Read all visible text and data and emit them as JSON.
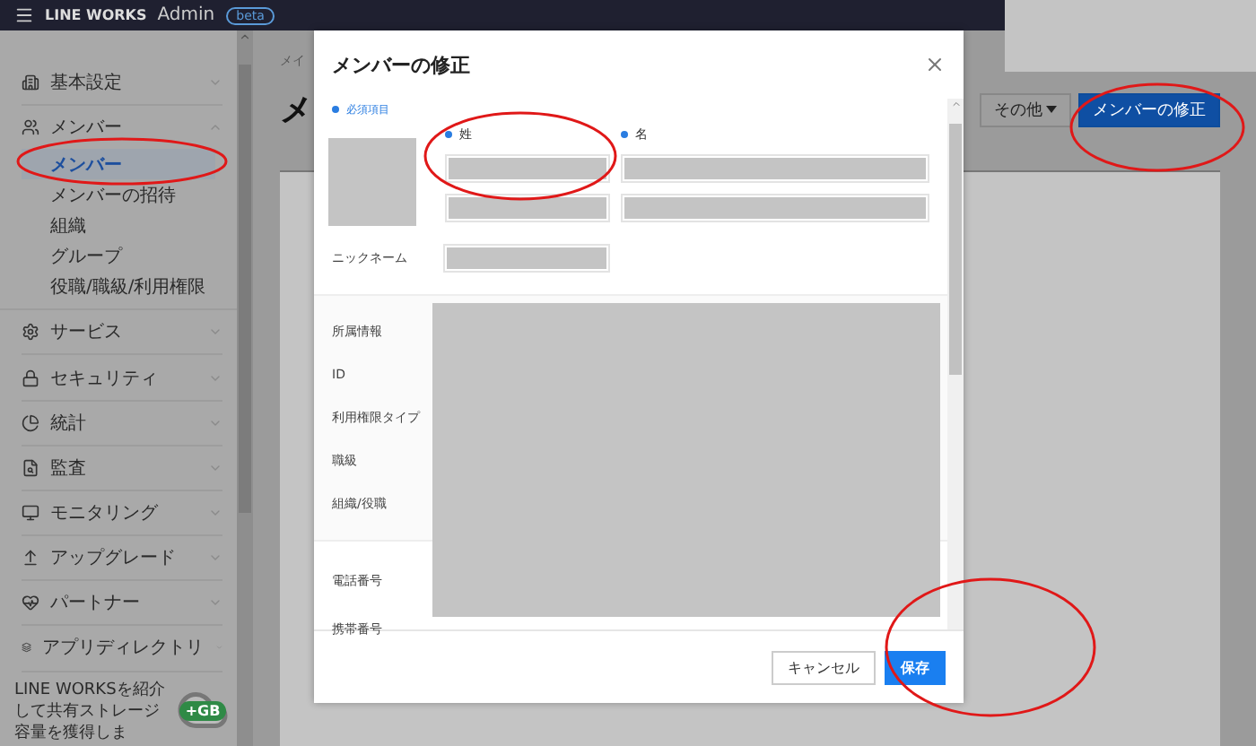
{
  "topbar": {
    "brand": "LINE WORKS",
    "product": "Admin",
    "badge": "beta"
  },
  "sidebar": {
    "sections": [
      {
        "label": "基本設定",
        "expanded": false
      },
      {
        "label": "メンバー",
        "expanded": true,
        "children": [
          {
            "label": "メンバー",
            "selected": true
          },
          {
            "label": "メンバーの招待",
            "selected": false
          },
          {
            "label": "組織",
            "selected": false
          },
          {
            "label": "グループ",
            "selected": false
          },
          {
            "label": "役職/職級/利用権限",
            "selected": false
          }
        ]
      },
      {
        "label": "サービス",
        "expanded": false
      },
      {
        "label": "セキュリティ",
        "expanded": false
      },
      {
        "label": "統計",
        "expanded": false
      },
      {
        "label": "監査",
        "expanded": false
      },
      {
        "label": "モニタリング",
        "expanded": false
      },
      {
        "label": "アップグレード",
        "expanded": false
      },
      {
        "label": "パートナー",
        "expanded": false
      },
      {
        "label": "アプリディレクトリ",
        "expanded": false
      }
    ],
    "promo": {
      "text": "LINE WORKSを紹介して共有ストレージ容量を獲得しま",
      "badge": "+GB"
    }
  },
  "main": {
    "breadcrumb": "メイ",
    "title": "メ",
    "actions": [
      {
        "label": "その他",
        "kind": "dropdown"
      },
      {
        "label": "メンバーの修正",
        "kind": "primary"
      }
    ]
  },
  "modal": {
    "title": "メンバーの修正",
    "required_note": "必須項目",
    "name_fields": [
      {
        "label": "姓"
      },
      {
        "label": "名"
      }
    ],
    "nickname_label": "ニックネーム",
    "info_labels": [
      "所属情報",
      "ID",
      "利用権限タイプ",
      "職級",
      "組織/役職"
    ],
    "contact_labels": [
      "電話番号",
      "携帯番号"
    ],
    "buttons": [
      {
        "label": "キャンセル",
        "kind": "secondary"
      },
      {
        "label": "保存",
        "kind": "primary"
      }
    ]
  }
}
